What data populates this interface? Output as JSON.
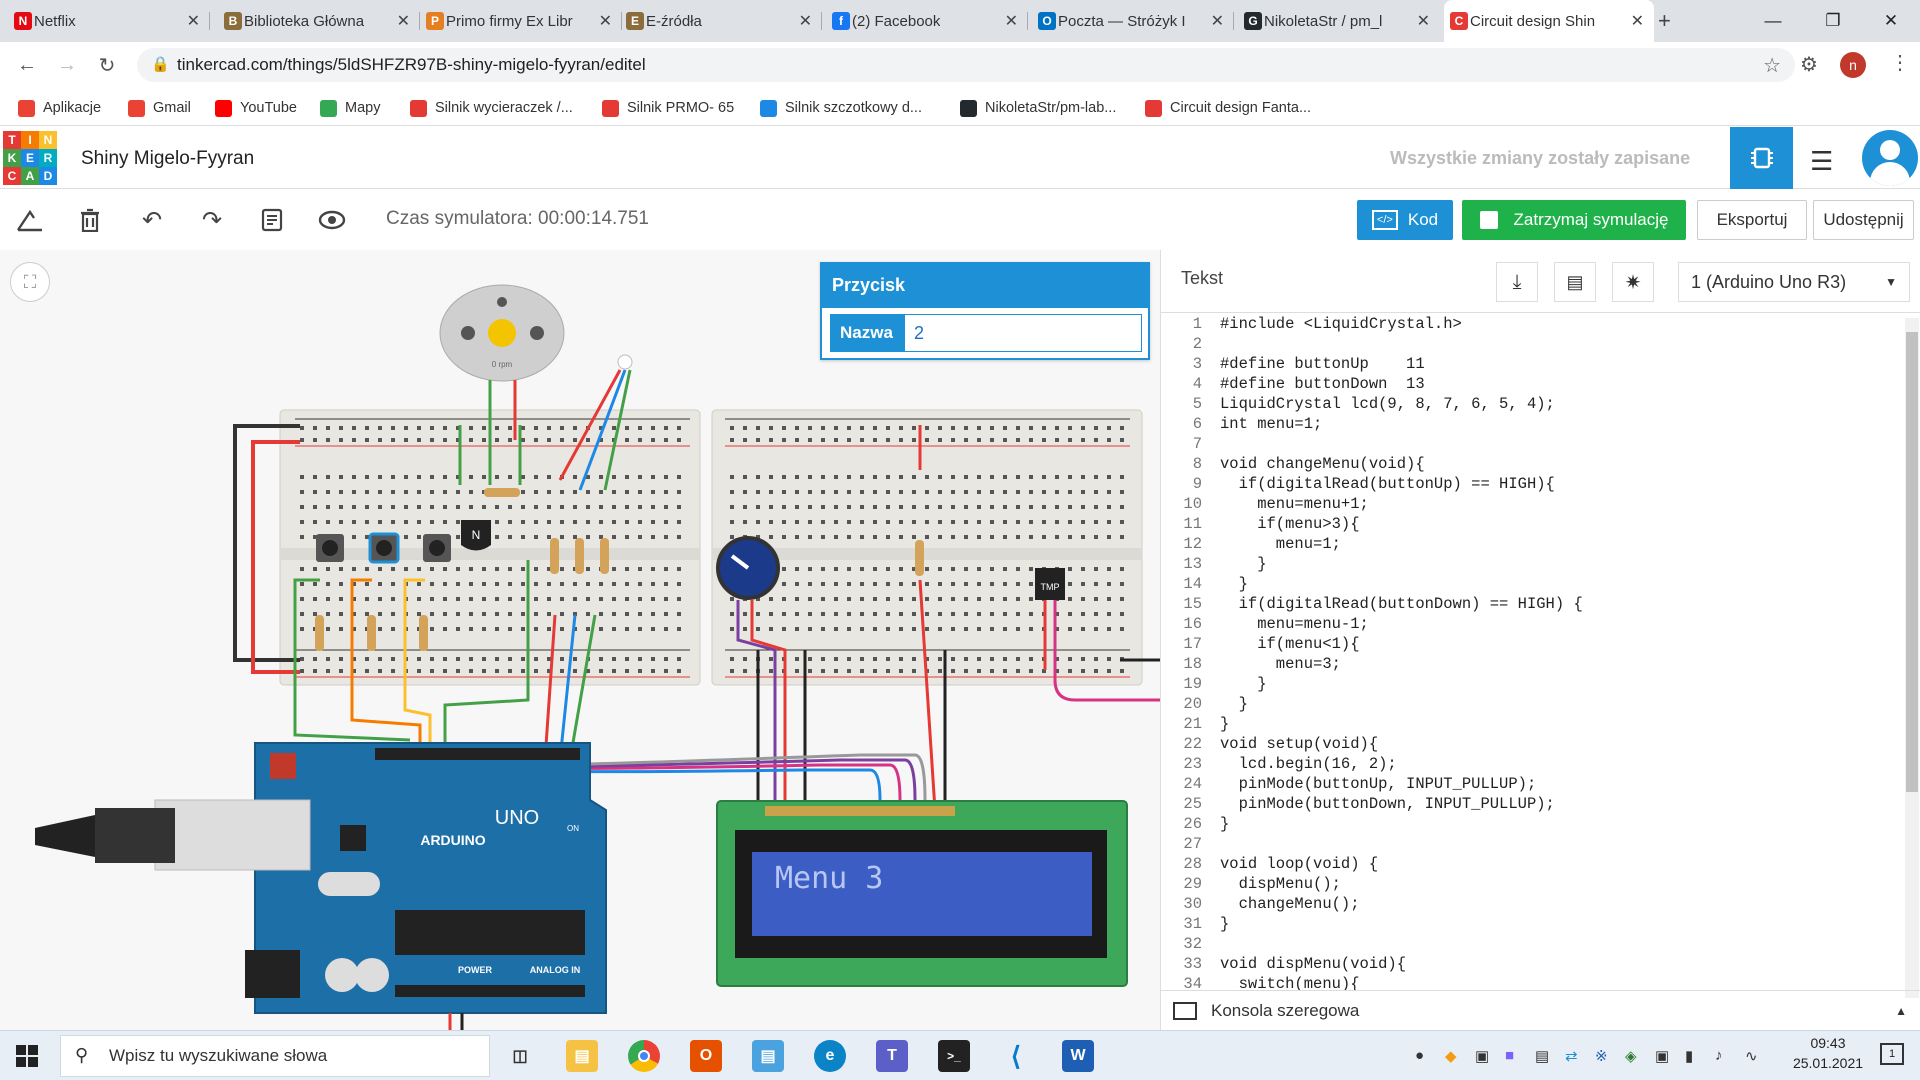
{
  "browser": {
    "tabs": [
      {
        "title": "Netflix",
        "fav": "N",
        "favcolor": "#e50914"
      },
      {
        "title": "Biblioteka Główna",
        "fav": "B",
        "favcolor": "#8a6d3b"
      },
      {
        "title": "Primo firmy Ex Libr",
        "fav": "P",
        "favcolor": "#e67e22"
      },
      {
        "title": "E-źródła",
        "fav": "E",
        "favcolor": "#8a6d3b"
      },
      {
        "title": "(2) Facebook",
        "fav": "f",
        "favcolor": "#1877f2"
      },
      {
        "title": "Poczta — Stróżyk I",
        "fav": "O",
        "favcolor": "#0072c6"
      },
      {
        "title": "NikoletaStr / pm_l",
        "fav": "G",
        "favcolor": "#24292e"
      },
      {
        "title": "Circuit design Shin",
        "fav": "C",
        "favcolor": "#e53935"
      }
    ],
    "new_tab": "+",
    "url": "tinkercad.com/things/5ldSHFZR97B-shiny-migelo-fyyran/editel",
    "profile_initial": "n",
    "bookmarks": [
      {
        "label": "Aplikacje",
        "color": "#ea4335"
      },
      {
        "label": "Gmail",
        "color": "#ea4335"
      },
      {
        "label": "YouTube",
        "color": "#ff0000"
      },
      {
        "label": "Mapy",
        "color": "#34a853"
      },
      {
        "label": "Silnik wycieraczek /...",
        "color": "#e53935"
      },
      {
        "label": "Silnik PRMO- 65",
        "color": "#e53935"
      },
      {
        "label": "Silnik szczotkowy d...",
        "color": "#1e88e5"
      },
      {
        "label": "NikoletaStr/pm-lab...",
        "color": "#24292e"
      },
      {
        "label": "Circuit design Fanta...",
        "color": "#e53935"
      }
    ]
  },
  "tinkercad": {
    "logo_letters": [
      "T",
      "I",
      "N",
      "K",
      "E",
      "R",
      "C",
      "A",
      "D"
    ],
    "logo_colors": [
      "#e53935",
      "#f57c00",
      "#fbc02d",
      "#43a047",
      "#1e88e5",
      "#00acc1",
      "#e53935",
      "#43a047",
      "#1e88e5"
    ],
    "project_title": "Shiny Migelo-Fyyran",
    "saved_status": "Wszystkie zmiany zostały zapisane",
    "simulator_time": "Czas symulatora: 00:00:14.751",
    "code_button": "Kod",
    "stop_sim_button": "Zatrzymaj symulację",
    "export_button": "Eksportuj",
    "share_button": "Udostępnij",
    "accent": "#1e90d6",
    "green": "#1fb24a"
  },
  "inspector": {
    "title": "Przycisk",
    "name_label": "Nazwa",
    "name_value": "2"
  },
  "circuit": {
    "motor_label": "0 rpm",
    "transistor_label": "N",
    "tmp_label": "TMP",
    "arduino_brand": "ARDUINO",
    "arduino_model": "UNO",
    "power_label": "POWER",
    "analog_label": "ANALOG IN",
    "on_label": "ON",
    "lcd_text": "Menu 3"
  },
  "code_panel": {
    "mode": "Tekst",
    "device": "1 (Arduino Uno R3)",
    "serial_console": "Konsola szeregowa",
    "lines": [
      "#include <LiquidCrystal.h>",
      "",
      "#define buttonUp    11",
      "#define buttonDown  13",
      "LiquidCrystal lcd(9, 8, 7, 6, 5, 4);",
      "int menu=1;",
      "",
      "void changeMenu(void){",
      "  if(digitalRead(buttonUp) == HIGH){",
      "    menu=menu+1;",
      "    if(menu>3){",
      "      menu=1;",
      "    }",
      "  }",
      "  if(digitalRead(buttonDown) == HIGH) {",
      "    menu=menu-1;",
      "    if(menu<1){",
      "      menu=3;",
      "    }",
      "  }",
      "}",
      "void setup(void){",
      "  lcd.begin(16, 2);",
      "  pinMode(buttonUp, INPUT_PULLUP);",
      "  pinMode(buttonDown, INPUT_PULLUP);",
      "}",
      "",
      "void loop(void) {",
      "  dispMenu();",
      "  changeMenu();",
      "}",
      "",
      "void dispMenu(void){",
      "  switch(menu){"
    ]
  },
  "taskbar": {
    "search_placeholder": "Wpisz tu wyszukiwane słowa",
    "time": "09:43",
    "date": "25.01.2021",
    "notifications": "1"
  }
}
